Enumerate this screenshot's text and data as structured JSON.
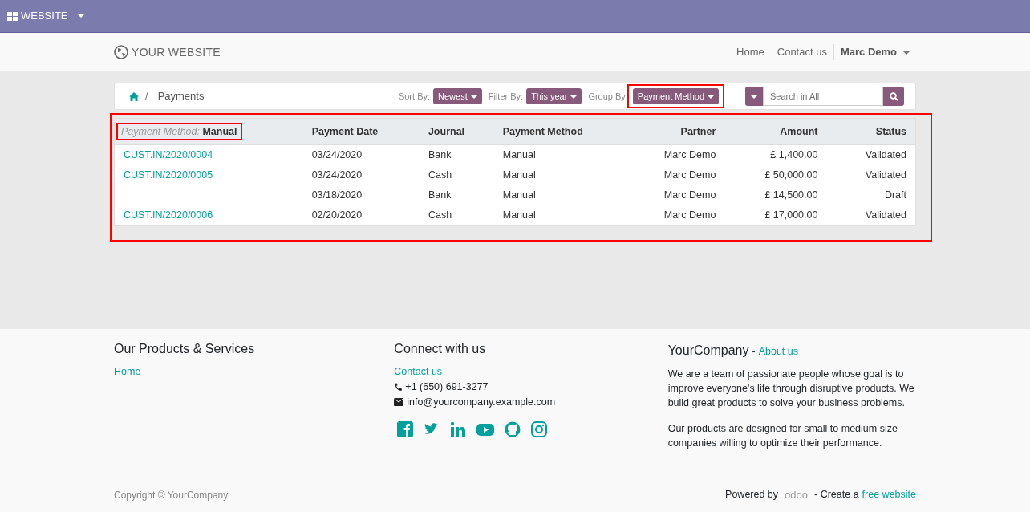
{
  "top_bar": {
    "app_label": "WEBSITE"
  },
  "header": {
    "logo_text": "YOUR WEBSITE",
    "nav": [
      {
        "label": "Home"
      },
      {
        "label": "Contact us"
      }
    ],
    "user": "Marc Demo"
  },
  "breadcrumb": {
    "separator": "/",
    "current": "Payments"
  },
  "controls": {
    "sort": {
      "label": "Sort By:",
      "value": "Newest"
    },
    "filter": {
      "label": "Filter By:",
      "value": "This year"
    },
    "group": {
      "label": "Group By",
      "value": "Payment Method",
      "highlighted": true
    },
    "search": {
      "placeholder": "Search in All"
    }
  },
  "table": {
    "highlighted": true,
    "group_header": {
      "label": "Payment Method:",
      "value": "Manual",
      "highlighted": true
    },
    "columns": [
      {
        "label": "Payment Date",
        "kind": "text"
      },
      {
        "label": "Journal",
        "kind": "text"
      },
      {
        "label": "Payment Method",
        "kind": "text"
      },
      {
        "label": "Partner",
        "kind": "trailing"
      },
      {
        "label": "Amount",
        "kind": "trailing"
      },
      {
        "label": "Status",
        "kind": "trailing"
      }
    ],
    "rows": [
      {
        "reference": "CUST.IN/2020/0004",
        "cells": [
          "03/24/2020",
          "Bank",
          "Manual",
          "Marc Demo",
          "£ 1,400.00",
          "Validated"
        ]
      },
      {
        "reference": "CUST.IN/2020/0005",
        "cells": [
          "03/24/2020",
          "Cash",
          "Manual",
          "Marc Demo",
          "£ 50,000.00",
          "Validated"
        ]
      },
      {
        "reference": null,
        "cells": [
          "03/18/2020",
          "Bank",
          "Manual",
          "Marc Demo",
          "£ 14,500.00",
          "Draft"
        ]
      },
      {
        "reference": "CUST.IN/2020/0006",
        "cells": [
          "02/20/2020",
          "Cash",
          "Manual",
          "Marc Demo",
          "£ 17,000.00",
          "Validated"
        ]
      }
    ]
  },
  "footer": {
    "products": {
      "title": "Our Products & Services",
      "links": [
        "Home"
      ]
    },
    "connect": {
      "title": "Connect with us",
      "link": "Contact us",
      "phone": "+1 (650) 691-3277",
      "email": "info@yourcompany.example.com",
      "social": [
        {
          "kind": "facebook"
        },
        {
          "kind": "twitter"
        },
        {
          "kind": "linkedin"
        },
        {
          "kind": "youtube"
        },
        {
          "kind": "github"
        },
        {
          "kind": "instagram"
        }
      ]
    },
    "about": {
      "title": "YourCompany",
      "separator": "-",
      "link": "About us",
      "paragraphs": [
        "We are a team of passionate people whose goal is to improve everyone's life through disruptive products. We build great products to solve your business problems.",
        "Our products are designed for small to medium size companies willing to optimize their performance."
      ]
    },
    "copyright": "Copyright © YourCompany",
    "powered": {
      "prefix": "Powered by",
      "logo": "odoo",
      "middle": "- Create a",
      "link": "free website"
    }
  }
}
